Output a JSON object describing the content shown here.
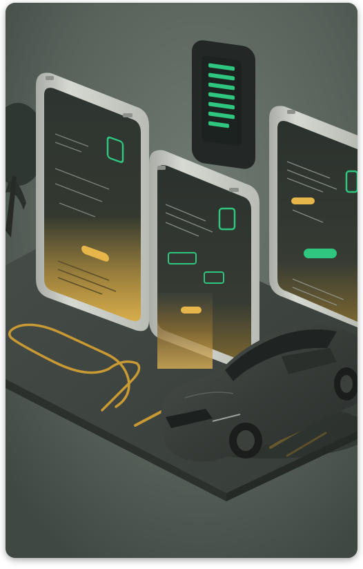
{
  "image": {
    "alt": "",
    "colors": {
      "background": "#59645d",
      "platform": "#3e4540",
      "phone_shell": "#c9ccc6",
      "phone_screen": "#2c322e",
      "accent_green": "#2fc77f",
      "accent_yellow": "#e0ad3c",
      "car_body": "#3a3f3c"
    },
    "icons": [
      "phone-mockup",
      "electric-car",
      "charging-cable",
      "tree"
    ]
  }
}
